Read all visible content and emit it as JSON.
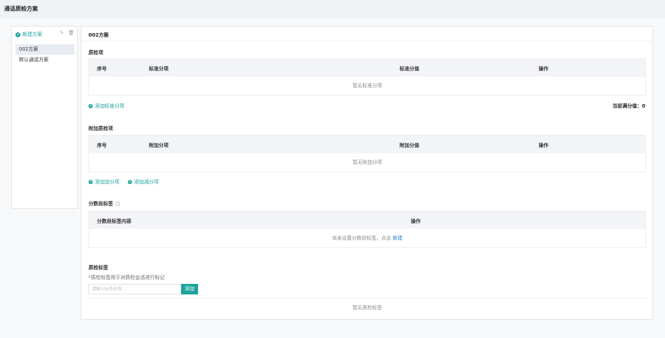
{
  "app": {
    "title": "通话质检方案"
  },
  "sidebar": {
    "new_label": "新建方案",
    "items": [
      {
        "label": "002方案",
        "active": true
      },
      {
        "label": "默认通话方案",
        "active": false
      }
    ]
  },
  "main": {
    "scheme_name": "002方案",
    "qc": {
      "title": "质检项",
      "headers": {
        "index": "序号",
        "item": "标准分项",
        "score": "标准分值",
        "op": "操作"
      },
      "empty": "暂无标准分项",
      "add_label": "添加标准分项",
      "full_score": "当前满分值：0"
    },
    "extra": {
      "title": "附加质检项",
      "headers": {
        "index": "序号",
        "item": "附加分项",
        "score": "附加分值",
        "op": "操作"
      },
      "empty": "暂无附加分项",
      "add_plus": "添加加分项",
      "add_minus": "添加减分项"
    },
    "score_tags": {
      "title": "分数段标签",
      "headers": {
        "content": "分数段标签内容",
        "op": "操作"
      },
      "empty_prefix": "尚未设置分数段标签，点击",
      "empty_link": "新建"
    },
    "qc_tags": {
      "title": "质检标签",
      "hint": "*质检标签用于对质检会话进行标记",
      "placeholder": "请输入标签名称...",
      "add_button": "添加",
      "empty": "暂无质检标签"
    }
  },
  "colors": {
    "accent": "#1ba39c",
    "link": "#1f7fd6"
  }
}
